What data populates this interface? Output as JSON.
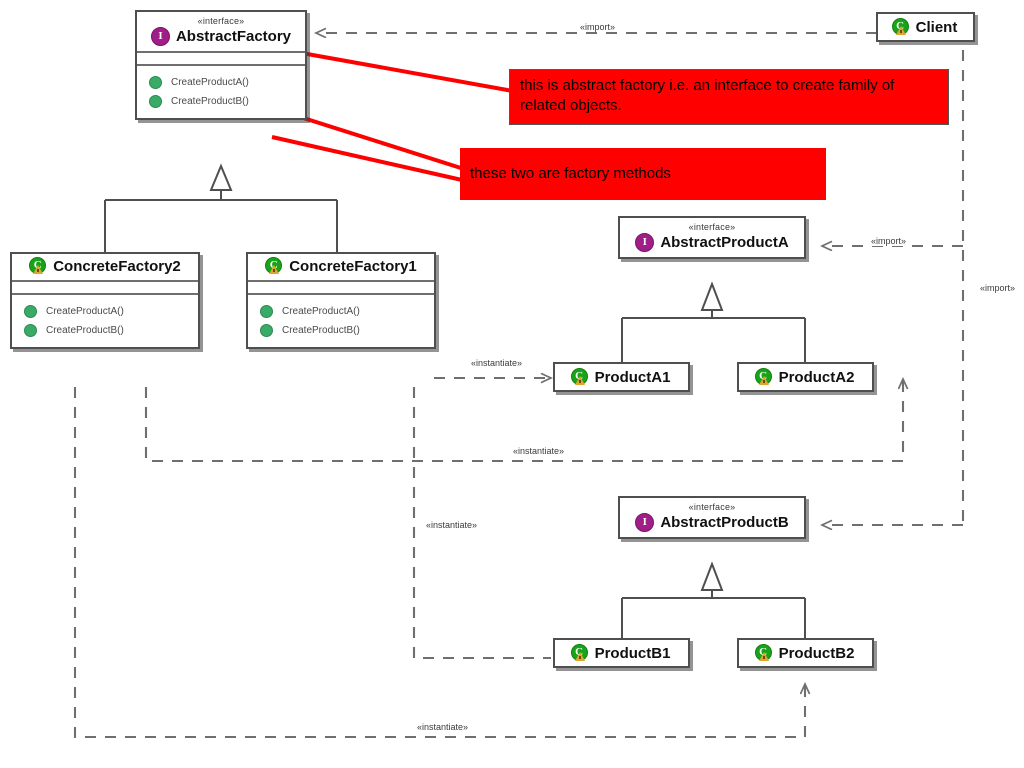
{
  "diagram": {
    "title": "Abstract Factory UML class diagram",
    "colors": {
      "note_fill": "#ff0000",
      "note_text": "#000000",
      "leader": "#ff0000",
      "interface_icon": "#a01e87",
      "class_icon": "#19a319",
      "operation_icon": "#3aab67",
      "edge": "#6f6f6f",
      "border": "#4f4f4f"
    },
    "stereotypes": {
      "interface": "«interface»",
      "import": "«import»",
      "instantiate": "«instantiate»"
    },
    "nodes": {
      "abstract_factory": {
        "stereotype": "«interface»",
        "name": "AbstractFactory",
        "icon": "interface-icon",
        "operations": [
          {
            "name": "CreateProductA()",
            "icon": "public-operation-icon"
          },
          {
            "name": "CreateProductB()",
            "icon": "public-operation-icon"
          }
        ]
      },
      "concrete_factory_2": {
        "name": "ConcreteFactory2",
        "icon": "class-icon",
        "operations": [
          {
            "name": "CreateProductA()",
            "icon": "public-operation-icon"
          },
          {
            "name": "CreateProductB()",
            "icon": "public-operation-icon"
          }
        ]
      },
      "concrete_factory_1": {
        "name": "ConcreteFactory1",
        "icon": "class-icon",
        "operations": [
          {
            "name": "CreateProductA()",
            "icon": "public-operation-icon"
          },
          {
            "name": "CreateProductB()",
            "icon": "public-operation-icon"
          }
        ]
      },
      "client": {
        "name": "Client",
        "icon": "class-icon"
      },
      "abstract_product_a": {
        "stereotype": "«interface»",
        "name": "AbstractProductA",
        "icon": "interface-icon"
      },
      "abstract_product_b": {
        "stereotype": "«interface»",
        "name": "AbstractProductB",
        "icon": "interface-icon"
      },
      "product_a1": {
        "name": "ProductA1",
        "icon": "class-icon"
      },
      "product_a2": {
        "name": "ProductA2",
        "icon": "class-icon"
      },
      "product_b1": {
        "name": "ProductB1",
        "icon": "class-icon"
      },
      "product_b2": {
        "name": "ProductB2",
        "icon": "class-icon"
      }
    },
    "edge_labels": {
      "import_client_factory": "«import»",
      "import_client_product_a": "«import»",
      "import_client_vertical": "«import»",
      "instantiate_cf1_a1": "«instantiate»",
      "instantiate_cf1_b1": "«instantiate»",
      "instantiate_cf2_a2": "«instantiate»",
      "instantiate_cf2_b2": "«instantiate»"
    },
    "notes": [
      {
        "id": "note-abstract-factory",
        "text": "this is abstract factory i.e. an interface to create family of related objects."
      },
      {
        "id": "note-factory-methods",
        "text": "these two are factory methods"
      }
    ]
  }
}
